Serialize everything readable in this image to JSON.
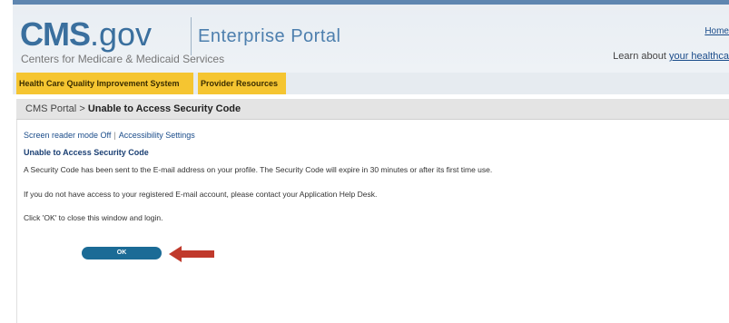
{
  "header": {
    "logo_cms": "CMS",
    "logo_gov": ".gov",
    "logo_tagline": "Enterprise Portal",
    "logo_subtitle": "Centers for Medicare & Medicaid Services",
    "home_link": "Home",
    "learn_prefix": "Learn about ",
    "learn_link": "your healthca"
  },
  "nav": {
    "items": [
      {
        "label": "Health Care Quality Improvement System"
      },
      {
        "label": "Provider Resources"
      }
    ],
    "accent_color": "#f5c531"
  },
  "breadcrumb": {
    "root": "CMS Portal",
    "separator": ">",
    "current": "Unable to Access Security Code"
  },
  "accessibility": {
    "screen_reader": "Screen reader mode Off",
    "separator": "|",
    "settings": "Accessibility Settings"
  },
  "main": {
    "title": "Unable to Access Security Code",
    "paragraphs": [
      "A Security Code has been sent to the E-mail address on your profile. The Security Code will expire in 30 minutes or after its first time use.",
      "If you do not have access to your registered E-mail account, please contact your Application Help Desk.",
      "Click 'OK' to close this window and login."
    ],
    "ok_button": "OK",
    "button_color": "#1b6b96",
    "annotation_arrow_color": "#c0392b"
  }
}
